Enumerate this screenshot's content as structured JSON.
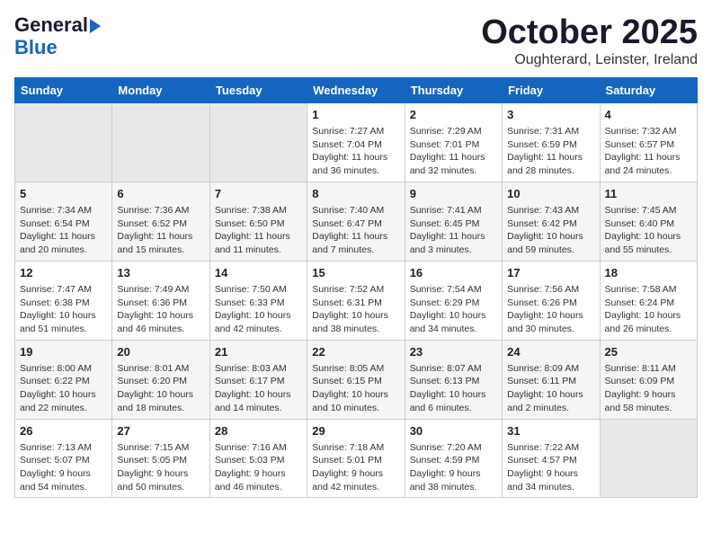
{
  "header": {
    "logo_general": "General",
    "logo_blue": "Blue",
    "month_title": "October 2025",
    "subtitle": "Oughterard, Leinster, Ireland"
  },
  "days_of_week": [
    "Sunday",
    "Monday",
    "Tuesday",
    "Wednesday",
    "Thursday",
    "Friday",
    "Saturday"
  ],
  "weeks": [
    [
      {
        "day": "",
        "content": ""
      },
      {
        "day": "",
        "content": ""
      },
      {
        "day": "",
        "content": ""
      },
      {
        "day": "1",
        "content": "Sunrise: 7:27 AM\nSunset: 7:04 PM\nDaylight: 11 hours\nand 36 minutes."
      },
      {
        "day": "2",
        "content": "Sunrise: 7:29 AM\nSunset: 7:01 PM\nDaylight: 11 hours\nand 32 minutes."
      },
      {
        "day": "3",
        "content": "Sunrise: 7:31 AM\nSunset: 6:59 PM\nDaylight: 11 hours\nand 28 minutes."
      },
      {
        "day": "4",
        "content": "Sunrise: 7:32 AM\nSunset: 6:57 PM\nDaylight: 11 hours\nand 24 minutes."
      }
    ],
    [
      {
        "day": "5",
        "content": "Sunrise: 7:34 AM\nSunset: 6:54 PM\nDaylight: 11 hours\nand 20 minutes."
      },
      {
        "day": "6",
        "content": "Sunrise: 7:36 AM\nSunset: 6:52 PM\nDaylight: 11 hours\nand 15 minutes."
      },
      {
        "day": "7",
        "content": "Sunrise: 7:38 AM\nSunset: 6:50 PM\nDaylight: 11 hours\nand 11 minutes."
      },
      {
        "day": "8",
        "content": "Sunrise: 7:40 AM\nSunset: 6:47 PM\nDaylight: 11 hours\nand 7 minutes."
      },
      {
        "day": "9",
        "content": "Sunrise: 7:41 AM\nSunset: 6:45 PM\nDaylight: 11 hours\nand 3 minutes."
      },
      {
        "day": "10",
        "content": "Sunrise: 7:43 AM\nSunset: 6:42 PM\nDaylight: 10 hours\nand 59 minutes."
      },
      {
        "day": "11",
        "content": "Sunrise: 7:45 AM\nSunset: 6:40 PM\nDaylight: 10 hours\nand 55 minutes."
      }
    ],
    [
      {
        "day": "12",
        "content": "Sunrise: 7:47 AM\nSunset: 6:38 PM\nDaylight: 10 hours\nand 51 minutes."
      },
      {
        "day": "13",
        "content": "Sunrise: 7:49 AM\nSunset: 6:36 PM\nDaylight: 10 hours\nand 46 minutes."
      },
      {
        "day": "14",
        "content": "Sunrise: 7:50 AM\nSunset: 6:33 PM\nDaylight: 10 hours\nand 42 minutes."
      },
      {
        "day": "15",
        "content": "Sunrise: 7:52 AM\nSunset: 6:31 PM\nDaylight: 10 hours\nand 38 minutes."
      },
      {
        "day": "16",
        "content": "Sunrise: 7:54 AM\nSunset: 6:29 PM\nDaylight: 10 hours\nand 34 minutes."
      },
      {
        "day": "17",
        "content": "Sunrise: 7:56 AM\nSunset: 6:26 PM\nDaylight: 10 hours\nand 30 minutes."
      },
      {
        "day": "18",
        "content": "Sunrise: 7:58 AM\nSunset: 6:24 PM\nDaylight: 10 hours\nand 26 minutes."
      }
    ],
    [
      {
        "day": "19",
        "content": "Sunrise: 8:00 AM\nSunset: 6:22 PM\nDaylight: 10 hours\nand 22 minutes."
      },
      {
        "day": "20",
        "content": "Sunrise: 8:01 AM\nSunset: 6:20 PM\nDaylight: 10 hours\nand 18 minutes."
      },
      {
        "day": "21",
        "content": "Sunrise: 8:03 AM\nSunset: 6:17 PM\nDaylight: 10 hours\nand 14 minutes."
      },
      {
        "day": "22",
        "content": "Sunrise: 8:05 AM\nSunset: 6:15 PM\nDaylight: 10 hours\nand 10 minutes."
      },
      {
        "day": "23",
        "content": "Sunrise: 8:07 AM\nSunset: 6:13 PM\nDaylight: 10 hours\nand 6 minutes."
      },
      {
        "day": "24",
        "content": "Sunrise: 8:09 AM\nSunset: 6:11 PM\nDaylight: 10 hours\nand 2 minutes."
      },
      {
        "day": "25",
        "content": "Sunrise: 8:11 AM\nSunset: 6:09 PM\nDaylight: 9 hours\nand 58 minutes."
      }
    ],
    [
      {
        "day": "26",
        "content": "Sunrise: 7:13 AM\nSunset: 5:07 PM\nDaylight: 9 hours\nand 54 minutes."
      },
      {
        "day": "27",
        "content": "Sunrise: 7:15 AM\nSunset: 5:05 PM\nDaylight: 9 hours\nand 50 minutes."
      },
      {
        "day": "28",
        "content": "Sunrise: 7:16 AM\nSunset: 5:03 PM\nDaylight: 9 hours\nand 46 minutes."
      },
      {
        "day": "29",
        "content": "Sunrise: 7:18 AM\nSunset: 5:01 PM\nDaylight: 9 hours\nand 42 minutes."
      },
      {
        "day": "30",
        "content": "Sunrise: 7:20 AM\nSunset: 4:59 PM\nDaylight: 9 hours\nand 38 minutes."
      },
      {
        "day": "31",
        "content": "Sunrise: 7:22 AM\nSunset: 4:57 PM\nDaylight: 9 hours\nand 34 minutes."
      },
      {
        "day": "",
        "content": ""
      }
    ]
  ]
}
